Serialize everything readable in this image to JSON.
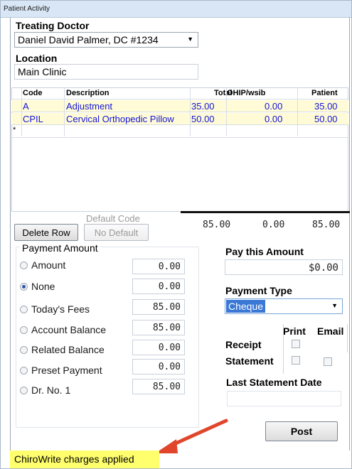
{
  "window": {
    "title": "Patient Activity"
  },
  "treating_doctor": {
    "label": "Treating Doctor",
    "selected": "Daniel David Palmer, DC #1234"
  },
  "location": {
    "label": "Location",
    "value": "Main Clinic"
  },
  "grid": {
    "headers": {
      "code": "Code",
      "description": "Description",
      "total": "Total",
      "ohip": "OHIP/wsib",
      "patient": "Patient"
    },
    "rows": [
      {
        "code": "A",
        "description": "Adjustment",
        "total": "35.00",
        "ohip": "0.00",
        "patient": "35.00"
      },
      {
        "code": "CPIL",
        "description": "Cervical Orthopedic Pillow",
        "total": "50.00",
        "ohip": "0.00",
        "patient": "50.00"
      }
    ],
    "new_row_marker": "*"
  },
  "default_code_label": "Default Code",
  "totals": {
    "total": "85.00",
    "ohip": "0.00",
    "patient": "85.00"
  },
  "buttons": {
    "delete_row": "Delete Row",
    "no_default": "No Default",
    "post": "Post"
  },
  "payment_amount": {
    "title": "Payment Amount",
    "options": [
      {
        "label": "Amount",
        "value": "0.00",
        "selected": false
      },
      {
        "label": "None",
        "value": "0.00",
        "selected": true
      },
      {
        "label": "Today's Fees",
        "value": "85.00",
        "selected": false
      },
      {
        "label": "Account Balance",
        "value": "85.00",
        "selected": false
      },
      {
        "label": "Related Balance",
        "value": "0.00",
        "selected": false
      },
      {
        "label": "Preset Payment",
        "value": "0.00",
        "selected": false
      },
      {
        "label": "Dr. No. 1",
        "value": "85.00",
        "selected": false
      }
    ]
  },
  "pay_this_amount": {
    "label": "Pay this Amount",
    "value": "$0.00"
  },
  "payment_type": {
    "label": "Payment Type",
    "selected": "Cheque"
  },
  "print_email": {
    "print_label": "Print",
    "email_label": "Email",
    "receipt_label": "Receipt",
    "statement_label": "Statement"
  },
  "last_statement": {
    "label": "Last Statement Date",
    "value": ""
  },
  "status_bar": {
    "text": "ChiroWrite charges applied",
    "color": "#ffff6e"
  },
  "annotation": {
    "arrow_color": "#e0462c"
  }
}
